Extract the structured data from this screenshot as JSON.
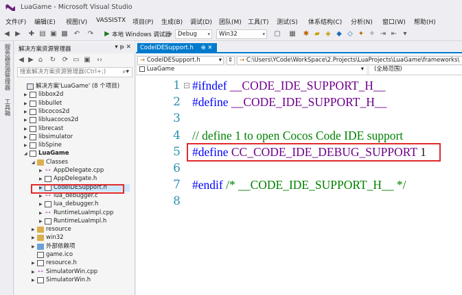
{
  "window": {
    "title": "LuaGame - Microsoft Visual Studio"
  },
  "menu": [
    "文件(F)",
    "编辑(E)",
    "视图(V)",
    "VASSISTX",
    "项目(P)",
    "生成(B)",
    "调试(D)",
    "团队(M)",
    "工具(T)",
    "测试(S)",
    "体系结构(C)",
    "分析(N)",
    "窗口(W)",
    "帮助(H)"
  ],
  "toolbar": {
    "run_label": "本地 Windows 调试器",
    "config": "Debug",
    "platform": "Win32"
  },
  "left_strip": {
    "tab1": "服务器资源管理器",
    "tab2": "工具箱"
  },
  "explorer": {
    "title": "解决方案资源管理器",
    "pin": "▾ ᵽ ✕",
    "search_placeholder": "搜索解决方案资源管理器(Ctrl+;)",
    "items": [
      {
        "label": "解决方案'LuaGame' (8 个项目)",
        "icon": "solution-icon",
        "indent": 0,
        "exp": ""
      },
      {
        "label": "libbox2d",
        "icon": "project-icon",
        "indent": 1,
        "exp": "▶"
      },
      {
        "label": "libbullet",
        "icon": "project-icon",
        "indent": 1,
        "exp": "▶"
      },
      {
        "label": "libcocos2d",
        "icon": "project-icon",
        "indent": 1,
        "exp": "▶"
      },
      {
        "label": "libluacocos2d",
        "icon": "project-icon",
        "indent": 1,
        "exp": "▶"
      },
      {
        "label": "librecast",
        "icon": "project-icon",
        "indent": 1,
        "exp": "▶"
      },
      {
        "label": "libsimulator",
        "icon": "project-icon",
        "indent": 1,
        "exp": "▶"
      },
      {
        "label": "libSpine",
        "icon": "project-icon",
        "indent": 1,
        "exp": "▶"
      },
      {
        "label": "LuaGame",
        "icon": "project-icon",
        "indent": 1,
        "exp": "◢",
        "bold": true
      },
      {
        "label": "Classes",
        "icon": "folder-icon",
        "indent": 2,
        "exp": "◢"
      },
      {
        "label": "AppDelegate.cpp",
        "icon": "cpp-file-icon",
        "indent": 3,
        "exp": "▶"
      },
      {
        "label": "AppDelegate.h",
        "icon": "header-file-icon",
        "indent": 3,
        "exp": "▶"
      },
      {
        "label": "CodeIDESupport.h",
        "icon": "header-file-icon",
        "indent": 3,
        "exp": "▶",
        "selected": true
      },
      {
        "label": "lua_debugger.c",
        "icon": "cpp-file-icon",
        "indent": 3,
        "exp": "▶"
      },
      {
        "label": "lua_debugger.h",
        "icon": "header-file-icon",
        "indent": 3,
        "exp": "▶"
      },
      {
        "label": "RuntimeLuaImpl.cpp",
        "icon": "cpp-file-icon",
        "indent": 3,
        "exp": "▶"
      },
      {
        "label": "RuntimeLuaImpl.h",
        "icon": "header-file-icon",
        "indent": 3,
        "exp": "▶"
      },
      {
        "label": "resource",
        "icon": "folder-icon",
        "indent": 2,
        "exp": "▶"
      },
      {
        "label": "win32",
        "icon": "folder-icon",
        "indent": 2,
        "exp": "▶"
      },
      {
        "label": "外部依赖项",
        "icon": "external-deps-icon",
        "indent": 2,
        "exp": "▶"
      },
      {
        "label": "game.ico",
        "icon": "ico-file-icon",
        "indent": 2,
        "exp": ""
      },
      {
        "label": "resource.h",
        "icon": "header-file-icon",
        "indent": 2,
        "exp": "▶"
      },
      {
        "label": "SimulatorWin.cpp",
        "icon": "cpp-file-icon",
        "indent": 2,
        "exp": "▶"
      },
      {
        "label": "SimulatorWin.h",
        "icon": "header-file-icon",
        "indent": 2,
        "exp": "▶"
      }
    ]
  },
  "editor": {
    "tab_label": "CodeIDESupport.h",
    "tab_pin": "⊕ ✕",
    "nav_file": "CodeIDESupport.h",
    "nav_path": "C:\\Users\\YCode\\WorkSpace\\2.Projects\\LuaProjects\\LuaGame\\frameworks\\",
    "scope_project": "LuaGame",
    "scope_global": "(全局范围)",
    "lines": [
      {
        "no": "1",
        "parts": [
          {
            "t": "#ifndef",
            "c": "kw-pre"
          },
          {
            "t": " __CODE_IDE_SUPPORT_H__",
            "c": "c-macro"
          }
        ]
      },
      {
        "no": "2",
        "parts": [
          {
            "t": "#define",
            "c": "kw-pre"
          },
          {
            "t": " __CODE_IDE_SUPPORT_H__",
            "c": "c-macro"
          }
        ]
      },
      {
        "no": "3",
        "parts": []
      },
      {
        "no": "4",
        "parts": [
          {
            "t": "// define 1 to open Cocos Code IDE support",
            "c": "c-comment"
          }
        ]
      },
      {
        "no": "5",
        "parts": [
          {
            "t": "#define",
            "c": "kw-pre"
          },
          {
            "t": " CC_CODE_IDE_DEBUG_SUPPORT",
            "c": "c-macro"
          },
          {
            "t": " 1",
            "c": ""
          }
        ]
      },
      {
        "no": "6",
        "parts": []
      },
      {
        "no": "7",
        "parts": [
          {
            "t": "#endif",
            "c": "kw-pre"
          },
          {
            "t": " /* __CODE_IDE_SUPPORT_H__ */",
            "c": "c-comment"
          }
        ]
      },
      {
        "no": "8",
        "parts": []
      }
    ]
  },
  "colors": {
    "accent": "#007acc",
    "highlight_box": "#e02a2a",
    "selection": "#cce8ff"
  }
}
